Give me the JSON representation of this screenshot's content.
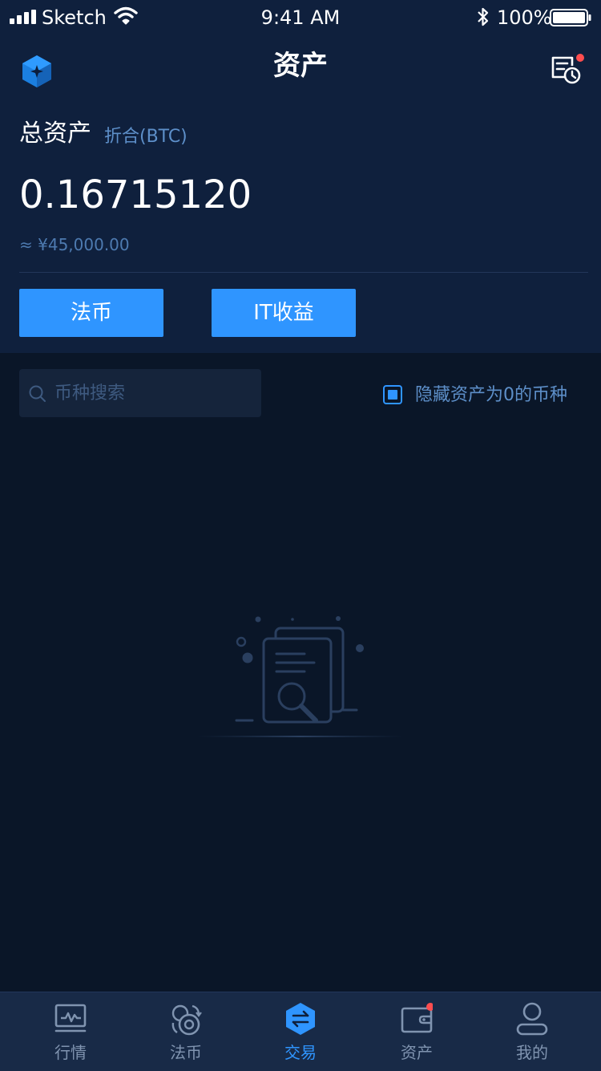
{
  "status_bar": {
    "carrier": "Sketch",
    "time": "9:41 AM",
    "battery": "100%"
  },
  "header": {
    "title": "资产",
    "logo_icon": "cube-logo-icon",
    "record_icon": "record-clock-icon",
    "has_notification": true
  },
  "summary": {
    "total_label": "总资产",
    "unit_label": "折合(BTC)",
    "total_value": "0.16715120",
    "cny_value": "≈ ¥45,000.00"
  },
  "actions": {
    "fiat_label": "法币",
    "it_label": "IT收益"
  },
  "search": {
    "placeholder": "币种搜索",
    "value": ""
  },
  "filter": {
    "hide_zero_label": "隐藏资产为0的币种",
    "checked": true
  },
  "tabs": [
    {
      "label": "行情",
      "icon": "market-chart-icon",
      "active": false
    },
    {
      "label": "法币",
      "icon": "fiat-exchange-icon",
      "active": false
    },
    {
      "label": "交易",
      "icon": "trade-hexagon-icon",
      "active": true
    },
    {
      "label": "资产",
      "icon": "wallet-icon",
      "active": false,
      "badge": true
    },
    {
      "label": "我的",
      "icon": "user-icon",
      "active": false
    }
  ],
  "colors": {
    "accent": "#2f95ff",
    "header_bg": "#0f203d",
    "page_bg": "#0a1628",
    "badge": "#ff4d4f"
  }
}
